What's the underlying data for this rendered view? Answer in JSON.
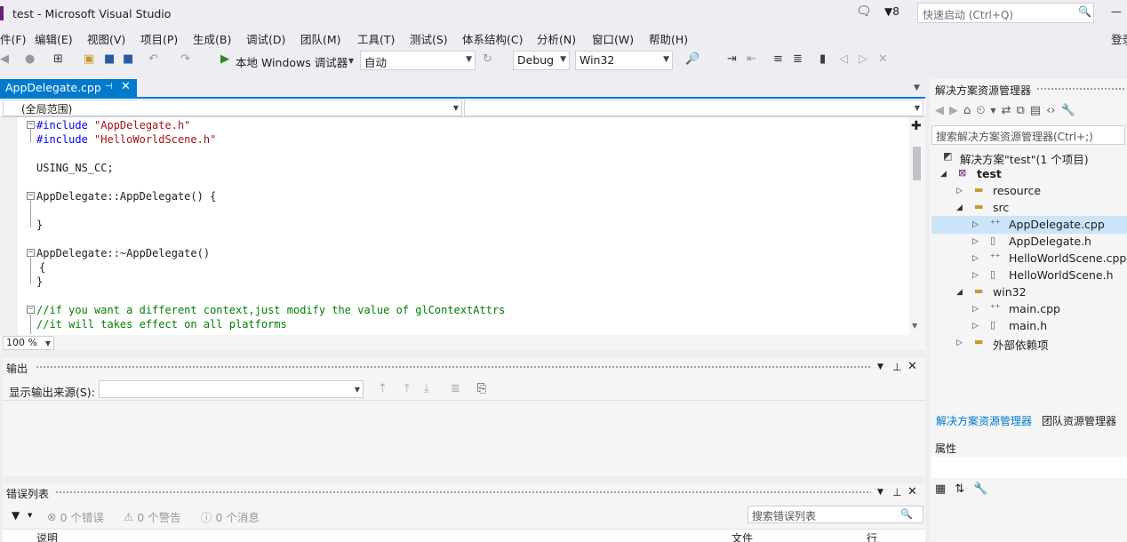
{
  "window": {
    "title": "test - Microsoft Visual Studio",
    "notification_count": "8"
  },
  "quick_launch": {
    "placeholder": "快速启动 (Ctrl+Q)"
  },
  "menu": [
    "件(F)",
    "编辑(E)",
    "视图(V)",
    "项目(P)",
    "生成(B)",
    "调试(D)",
    "团队(M)",
    "工具(T)",
    "测试(S)",
    "体系结构(C)",
    "分析(N)",
    "窗口(W)",
    "帮助(H)",
    "登录"
  ],
  "toolbar": {
    "run_label": "本地 Windows 调试器",
    "solution_config": "自动",
    "configuration": "Debug",
    "platform": "Win32"
  },
  "editor": {
    "tab_label": "AppDelegate.cpp",
    "scope": "(全局范围)",
    "zoom": "100 %",
    "lines": [
      "#include \"AppDelegate.h\"",
      "#include \"HelloWorldScene.h\"",
      "",
      "USING_NS_CC;",
      "",
      "AppDelegate::AppDelegate() {",
      "",
      "}",
      "",
      "AppDelegate::~AppDelegate()",
      "{",
      "}",
      "",
      "//if you want a different context,just modify the value of glContextAttrs",
      "//it will takes effect on all platforms"
    ]
  },
  "output": {
    "title": "输出",
    "source_label": "显示输出来源(S):",
    "source_value": ""
  },
  "error_list": {
    "title": "错误列表",
    "errors": "0 个错误",
    "warnings": "0 个警告",
    "messages": "0 个消息",
    "search_placeholder": "搜索错误列表",
    "col_description": "说明",
    "col_file": "文件",
    "col_line": "行"
  },
  "solution_explorer": {
    "title": "解决方案资源管理器",
    "search_placeholder": "搜索解决方案资源管理器(Ctrl+;)",
    "tree": [
      {
        "label": "解决方案\"test\"(1 个项目)",
        "level": 0,
        "expander": "",
        "icon": "solution-icon"
      },
      {
        "label": "test",
        "level": 1,
        "expander": "open",
        "icon": "project-icon"
      },
      {
        "label": "resource",
        "level": 2,
        "expander": "closed",
        "icon": "folder-icon"
      },
      {
        "label": "src",
        "level": 2,
        "expander": "open",
        "icon": "folder-icon"
      },
      {
        "label": "AppDelegate.cpp",
        "level": 3,
        "expander": "closed",
        "icon": "cpp-file-icon"
      },
      {
        "label": "AppDelegate.h",
        "level": 3,
        "expander": "closed",
        "icon": "header-file-icon"
      },
      {
        "label": "HelloWorldScene.cpp",
        "level": 3,
        "expander": "closed",
        "icon": "cpp-file-icon"
      },
      {
        "label": "HelloWorldScene.h",
        "level": 3,
        "expander": "closed",
        "icon": "header-file-icon"
      },
      {
        "label": "win32",
        "level": 2,
        "expander": "open",
        "icon": "folder-icon"
      },
      {
        "label": "main.cpp",
        "level": 3,
        "expander": "closed",
        "icon": "cpp-file-icon"
      },
      {
        "label": "main.h",
        "level": 3,
        "expander": "closed",
        "icon": "header-file-icon"
      },
      {
        "label": "外部依赖项",
        "level": 2,
        "expander": "closed",
        "icon": "external-deps-icon"
      }
    ],
    "selected_index": 4,
    "tab_solution": "解决方案资源管理器",
    "tab_team": "团队资源管理器"
  },
  "properties": {
    "title": "属性"
  },
  "colors": {
    "accent": "#007acc",
    "keyword": "#0000ff",
    "string": "#a31515",
    "comment": "#008000"
  }
}
